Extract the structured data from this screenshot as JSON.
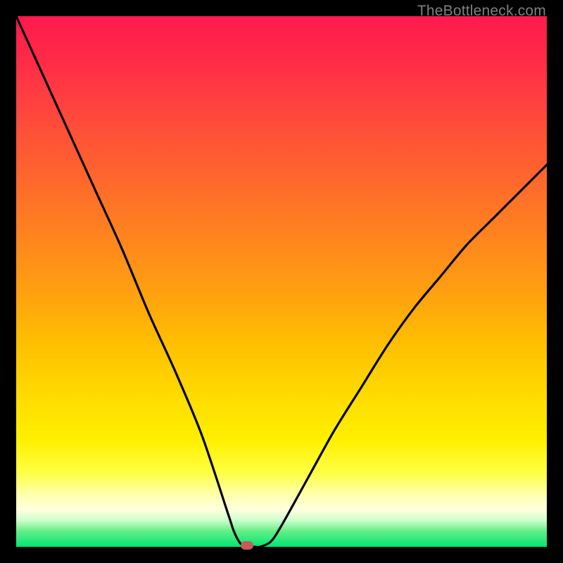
{
  "watermark": "TheBottleneck.com",
  "colors": {
    "frame": "#000000",
    "gradient_top": "#ff1a4d",
    "gradient_bottom": "#00e673",
    "curve": "#000000",
    "marker": "#c85a5a",
    "watermark": "#808080"
  },
  "chart_data": {
    "type": "line",
    "title": "",
    "xlabel": "",
    "ylabel": "",
    "xlim": [
      0,
      100
    ],
    "ylim": [
      0,
      100
    ],
    "series": [
      {
        "name": "bottleneck-curve",
        "x": [
          0,
          5,
          10,
          15,
          20,
          25,
          30,
          35,
          40,
          41,
          42,
          43,
          44,
          45,
          46,
          48,
          50,
          55,
          60,
          65,
          70,
          75,
          80,
          85,
          90,
          95,
          100
        ],
        "values": [
          100,
          89,
          78,
          67,
          56,
          44,
          33,
          21,
          6,
          3,
          1,
          0,
          0,
          0,
          0,
          1,
          4,
          13,
          22,
          30,
          38,
          45,
          51,
          57,
          62,
          67,
          72
        ]
      }
    ],
    "marker": {
      "x": 43.5,
      "y": 0
    },
    "annotations": []
  }
}
